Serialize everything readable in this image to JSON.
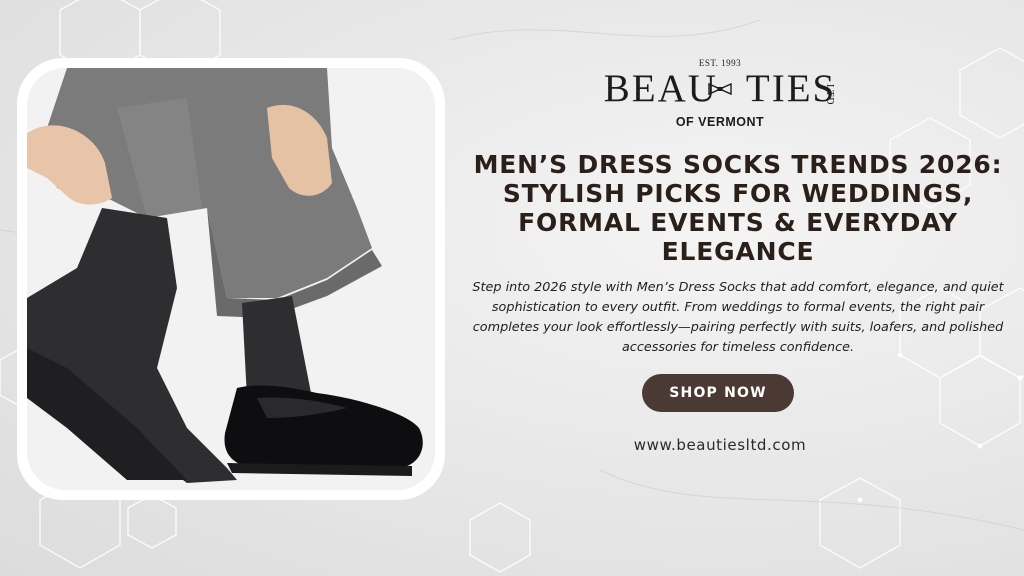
{
  "logo": {
    "est": "EST. 1993",
    "brand_left": "BEAU",
    "brand_right": "TIES",
    "ltd": "LTD",
    "location": "OF VERMONT"
  },
  "headline": "MEN’S DRESS SOCKS TRENDS 2026: STYLISH PICKS FOR WEDDINGS, FORMAL EVENTS & EVERYDAY ELEGANCE",
  "description": "Step into 2026 style with Men’s Dress Socks that add comfort, elegance, and quiet sophistication to every outfit. From weddings to formal events, the right pair completes your look effortlessly—pairing perfectly with suits, loafers, and polished accessories for timeless confidence.",
  "cta": {
    "label": "SHOP NOW"
  },
  "website": "www.beautiesltd.com",
  "colors": {
    "button": "#4a3a33",
    "headline": "#2b1f1a",
    "sock": "#2f2f31",
    "trousers": "#7d7d7d"
  },
  "photo": {
    "subject": "man-in-grey-trousers-pulling-up-dark-dress-socks-with-black-oxford-shoe"
  }
}
